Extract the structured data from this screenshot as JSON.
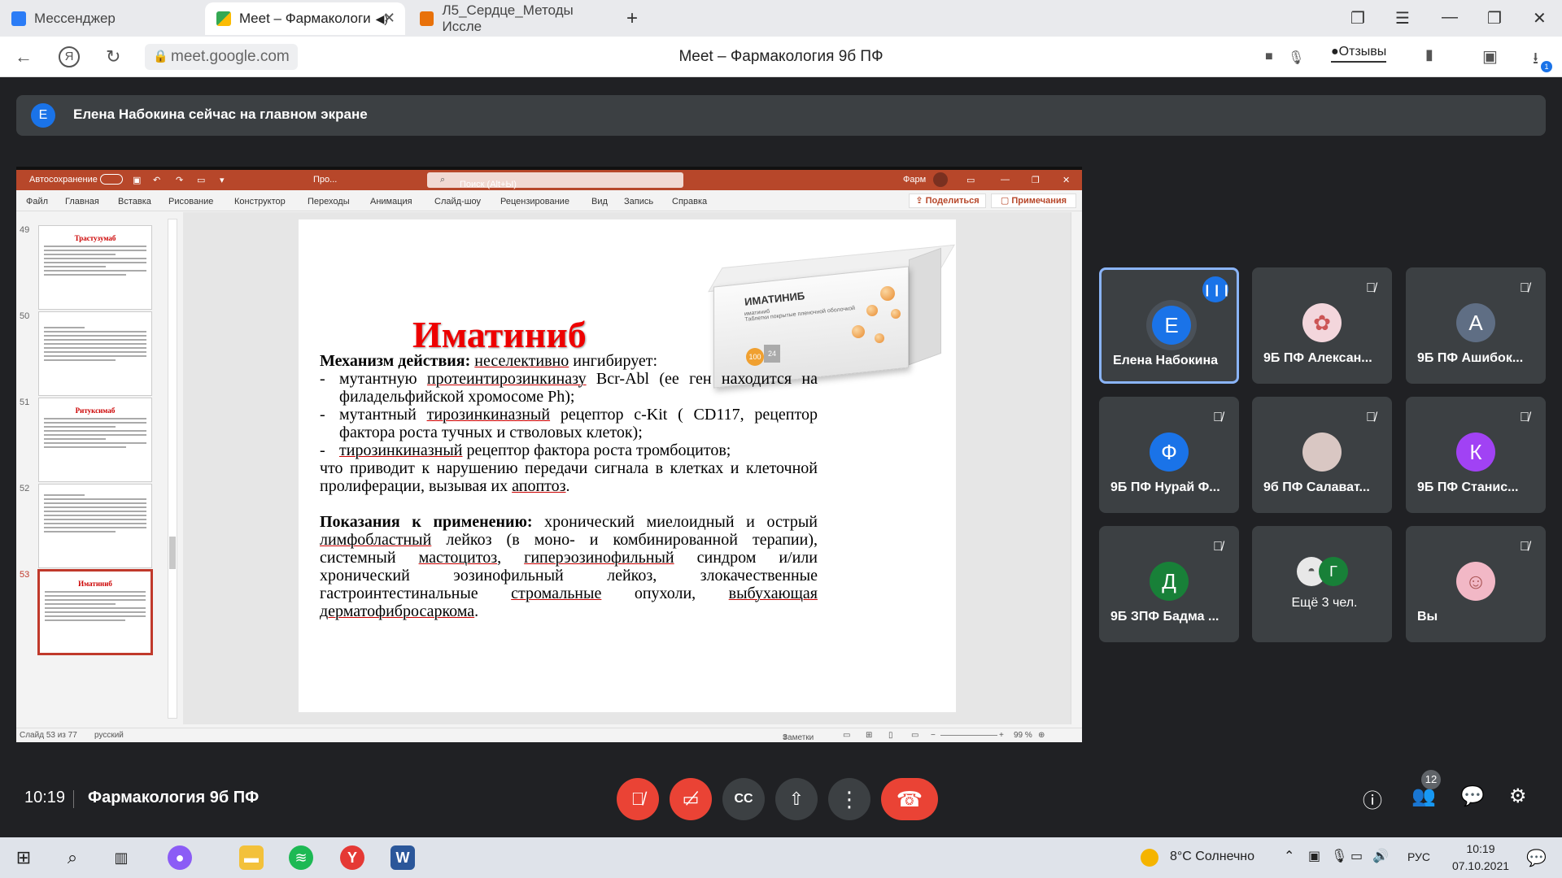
{
  "browser": {
    "tabs": [
      {
        "label": "Мессенджер",
        "active": false
      },
      {
        "label": "Meet – Фармакологи",
        "active": true
      },
      {
        "label": "Л5_Сердце_Методы Иссле",
        "active": false
      }
    ],
    "url": "meet.google.com",
    "page_title": "Meet – Фармакология 9б ПФ",
    "feedback_label": "Отзывы",
    "download_count": "1"
  },
  "meet": {
    "banner_initial": "Е",
    "banner_text": "Елена Набокина сейчас на главном экране",
    "time": "10:19",
    "meeting_name": "Фармакология 9б ПФ",
    "people_count": "12",
    "participants": [
      {
        "initial": "Е",
        "name": "Елена Набокина",
        "color": "#1a73e8",
        "speaking": true
      },
      {
        "initial": "",
        "name": "9Б ПФ Алексан...",
        "color": "#f3d6dc",
        "speaking": false
      },
      {
        "initial": "А",
        "name": "9Б ПФ Ашибок...",
        "color": "#5f6e84",
        "speaking": false
      },
      {
        "initial": "Ф",
        "name": "9Б ПФ Нурай Ф...",
        "color": "#1a73e8",
        "speaking": false
      },
      {
        "initial": "",
        "name": "9б ПФ Салават...",
        "color": "#d9c7c3",
        "speaking": false
      },
      {
        "initial": "К",
        "name": "9Б ПФ Станис...",
        "color": "#a142f4",
        "speaking": false
      },
      {
        "initial": "Д",
        "name": "9Б ЗПФ Бадма ...",
        "color": "#188038",
        "speaking": false
      },
      {
        "initial": "Г",
        "name": "Ещё 3 чел.",
        "color": "#188038",
        "speaking": false
      },
      {
        "initial": "",
        "name": "Вы",
        "color": "#f2b8c6",
        "speaking": false
      }
    ]
  },
  "ppt": {
    "autosave": "Автосохранение",
    "doc_short": "Про...",
    "search": "Поиск (Alt+Ы)",
    "user_short": "Фарм",
    "menu": [
      "Файл",
      "Главная",
      "Вставка",
      "Рисование",
      "Конструктор",
      "Переходы",
      "Анимация",
      "Слайд-шоу",
      "Рецензирование",
      "Вид",
      "Запись",
      "Справка"
    ],
    "share": "Поделиться",
    "notes_btn": "Примечания",
    "thumbs": [
      {
        "num": "49",
        "title": "Трастузумаб"
      },
      {
        "num": "50",
        "title": ""
      },
      {
        "num": "51",
        "title": "Ритуксимаб"
      },
      {
        "num": "52",
        "title": ""
      },
      {
        "num": "53",
        "title": "Иматиниб"
      }
    ],
    "status_slide": "Слайд 53 из 77",
    "status_lang": "русский",
    "status_notes": "Заметки",
    "zoom": "99 %"
  },
  "slide": {
    "title": "Иматиниб",
    "box_name": "ИМАТИНИБ",
    "box_sub": "иматиниб",
    "box_desc": "Таблетки покрытые пленочной оболочкой",
    "box_dose": "100",
    "box_count": "24",
    "mech_label": "Механизм действия:",
    "mech_u": "неселективно",
    "mech_rest": " ингибирует:",
    "b1_a": "мутантную ",
    "b1_u": "протеинтирозинкиназу",
    "b1_b": " Bcr-Abl (ее ген находится на филадельфийской хромосоме Ph);",
    "b2_a": "мутантный ",
    "b2_u": "тирозинкиназный",
    "b2_b": " рецептор c-Kit ( CD117, рецептор фактора роста тучных и стволовых клеток);",
    "b3_u": "тирозинкиназный",
    "b3_b": " рецептор фактора роста тромбоцитов;",
    "result_a": "что приводит к нарушению передачи сигнала в клетках и клеточной пролиферации, вызывая их ",
    "result_u": "апоптоз",
    "result_b": ".",
    "ind_label": "Показания к применению:",
    "ind_a": " хронический миелоидный и острый ",
    "ind_u1": "лимфобластный",
    "ind_b": " лейкоз (в моно- и комбинированной терапии), системный ",
    "ind_u2": "мастоцитоз",
    "ind_c": ", ",
    "ind_u3": "гиперэозинофильный",
    "ind_d": " синдром и/или хронический эозинофильный лейкоз, злокачественные гастроинтестинальные ",
    "ind_u4": "стромальные",
    "ind_e": " опухоли, ",
    "ind_u5": "выбухающая",
    "ind_f": " ",
    "ind_u6": "дерматофибросаркома",
    "ind_g": "."
  },
  "taskbar": {
    "weather": "8°C  Солнечно",
    "lang": "РУС",
    "time": "10:19",
    "date": "07.10.2021"
  }
}
